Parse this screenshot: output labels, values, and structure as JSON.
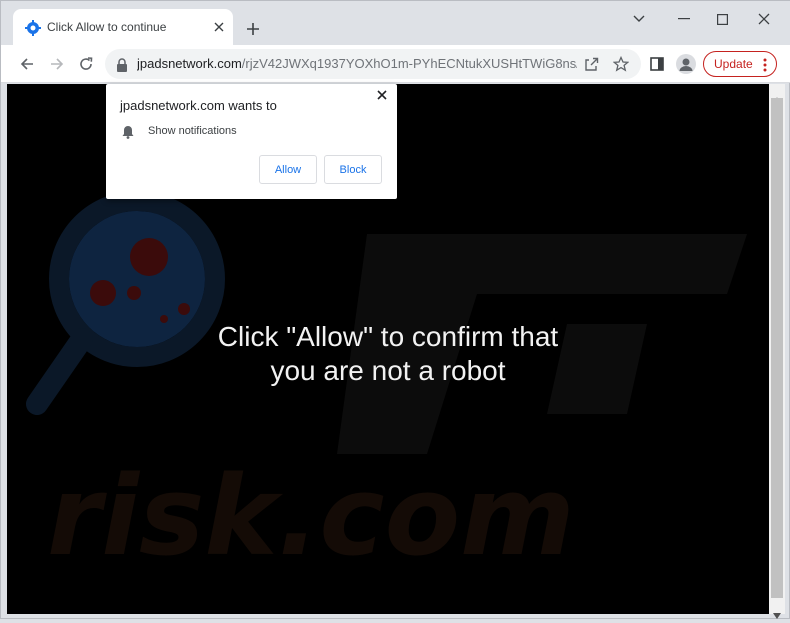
{
  "tab": {
    "title": "Click Allow to continue"
  },
  "toolbar": {
    "url_host": "jpadsnetwork.com",
    "url_path": "/rjzV42JWXq1937YOXhO1m-PYhECNtukXUSHtTWiG8ns/?...",
    "update_label": "Update"
  },
  "popup": {
    "title": "jpadsnetwork.com wants to",
    "permission": "Show notifications",
    "allow_label": "Allow",
    "block_label": "Block"
  },
  "page": {
    "headline_line1": "Click \"Allow\" to confirm that",
    "headline_line2": "you are not a robot",
    "watermark_text": "risk.com"
  },
  "colors": {
    "background": "#000000",
    "accent_blue": "#1a73e8",
    "update_red": "#c5221f",
    "headline": "#f2f2f2"
  }
}
